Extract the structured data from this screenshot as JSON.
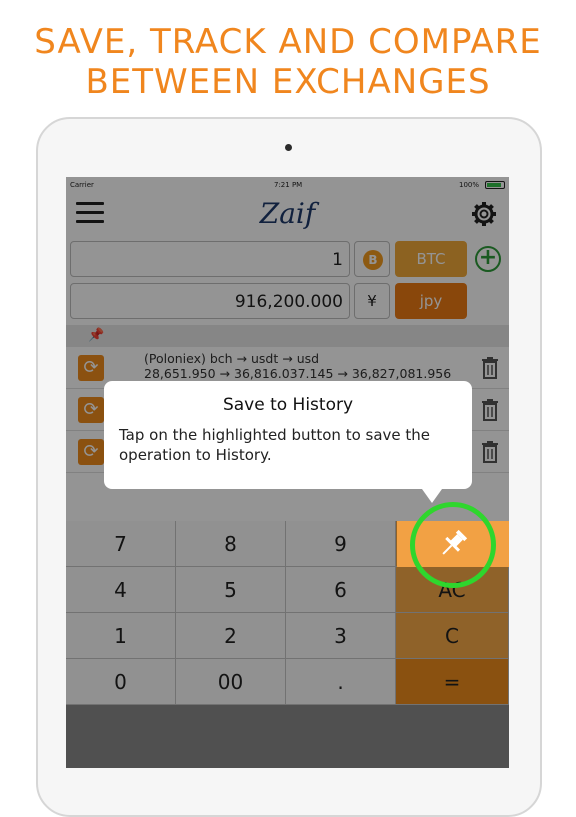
{
  "headline": {
    "line1": "SAVE, TRACK AND COMPARE",
    "line2": "BETWEEN EXCHANGES"
  },
  "status_bar": {
    "carrier": "Carrier",
    "time": "7:21 PM",
    "battery": "100%"
  },
  "nav": {
    "logo": "Zaif",
    "menu_icon": "hamburger-menu-icon",
    "settings_icon": "gear-icon"
  },
  "converter": {
    "amount_value": "1",
    "coin_icon": "bitcoin-icon",
    "from_currency": "BTC",
    "result_value": "916,200.000",
    "yen_symbol": "¥",
    "to_currency": "jpy",
    "add_icon": "plus-circle-icon"
  },
  "history": [
    {
      "line1": "(Poloniex) bch → usdt → usd",
      "line2": "28,651.950 → 36,816.037.145 → 36,827,081.956"
    },
    {
      "line1": "",
      "line2": ""
    },
    {
      "line1": "",
      "line2": ""
    }
  ],
  "tooltip": {
    "title": "Save to History",
    "body": "Tap on the highlighted button to save the operation to History."
  },
  "keypad": {
    "row1": [
      "7",
      "8",
      "9"
    ],
    "row2": [
      "4",
      "5",
      "6"
    ],
    "op2": "AC",
    "row3": [
      "1",
      "2",
      "3"
    ],
    "op3": "C",
    "row4": [
      "0",
      "00",
      "."
    ],
    "op4": "=",
    "pin_icon": "pushpin-icon"
  },
  "colors": {
    "headline": "#f0861e",
    "accent_light": "#f7a948",
    "accent_dark": "#ee8c1c",
    "highlight": "#2fd62d"
  }
}
